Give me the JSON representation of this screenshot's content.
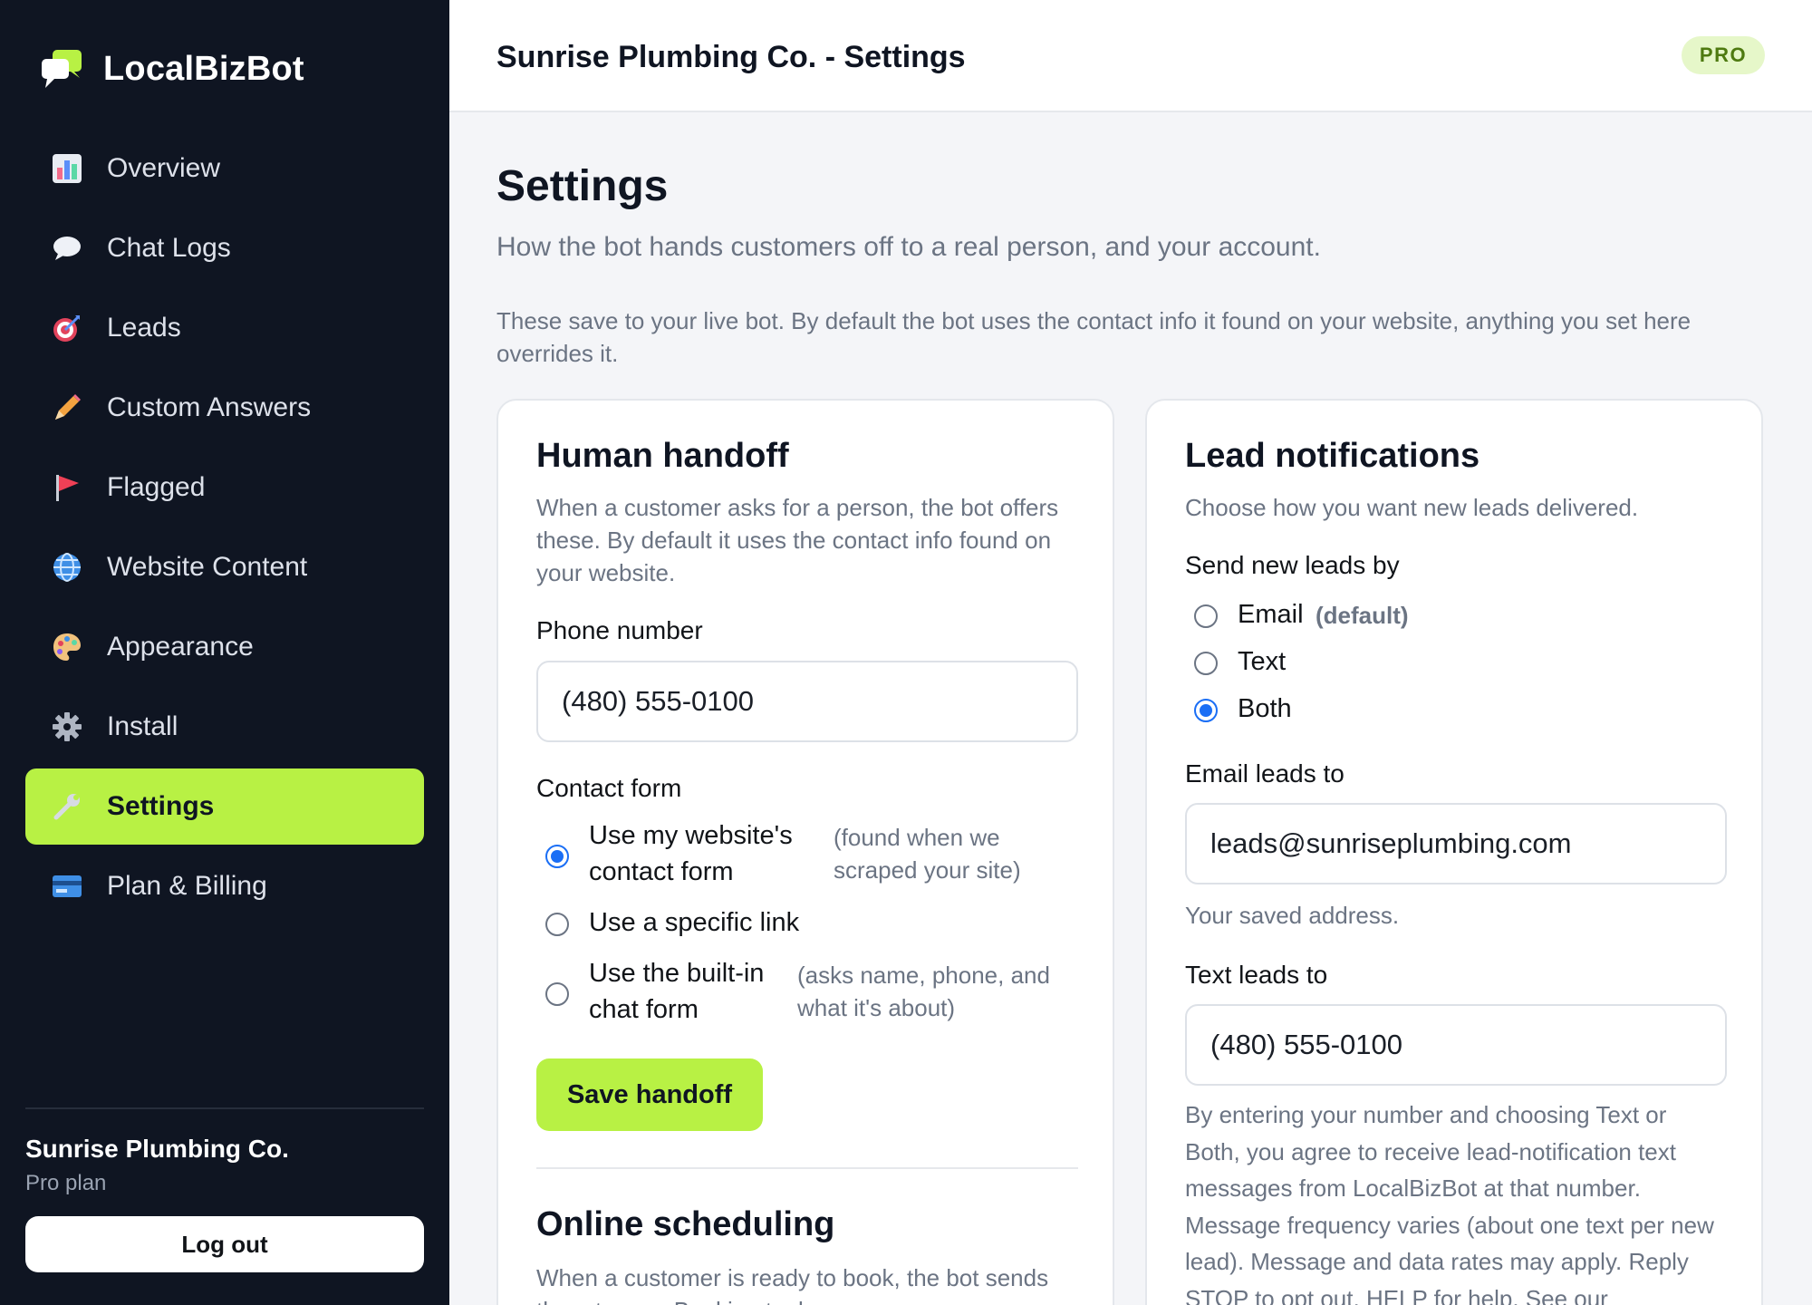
{
  "app": {
    "name": "LocalBizBot"
  },
  "sidebar": {
    "items": [
      {
        "label": "Overview",
        "icon": "bar-chart-icon"
      },
      {
        "label": "Chat Logs",
        "icon": "speech-bubble-icon"
      },
      {
        "label": "Leads",
        "icon": "target-icon"
      },
      {
        "label": "Custom Answers",
        "icon": "pencil-icon"
      },
      {
        "label": "Flagged",
        "icon": "flag-icon"
      },
      {
        "label": "Website Content",
        "icon": "globe-icon"
      },
      {
        "label": "Appearance",
        "icon": "palette-icon"
      },
      {
        "label": "Install",
        "icon": "gear-icon"
      },
      {
        "label": "Settings",
        "icon": "wrench-icon",
        "active": true
      },
      {
        "label": "Plan & Billing",
        "icon": "credit-card-icon"
      }
    ],
    "org_name": "Sunrise Plumbing Co.",
    "plan": "Pro plan",
    "logout_label": "Log out"
  },
  "header": {
    "title": "Sunrise Plumbing Co. - Settings",
    "badge": "PRO"
  },
  "page": {
    "title": "Settings",
    "subtitle": "How the bot hands customers off to a real person, and your account.",
    "note": "These save to your live bot. By default the bot uses the contact info it found on your website, anything you set here overrides it."
  },
  "handoff": {
    "title": "Human handoff",
    "desc": "When a customer asks for a person, the bot offers these. By default it uses the contact info found on your website.",
    "phone_label": "Phone number",
    "phone_value": "(480) 555-0100",
    "contact_form_label": "Contact form",
    "options": [
      {
        "label": "Use my website's contact form",
        "hint": "(found when we scraped your site)",
        "checked": true
      },
      {
        "label": "Use a specific link",
        "hint": "",
        "checked": false
      },
      {
        "label": "Use the built-in chat form",
        "hint": "(asks name, phone, and what it's about)",
        "checked": false
      }
    ],
    "save_label": "Save handoff",
    "scheduling_title": "Online scheduling",
    "scheduling_desc": "When a customer is ready to book, the bot sends them to your Booking tool."
  },
  "leads": {
    "title": "Lead notifications",
    "desc": "Choose how you want new leads delivered.",
    "send_by_label": "Send new leads by",
    "options": [
      {
        "label": "Email",
        "hint": "(default)",
        "checked": false
      },
      {
        "label": "Text",
        "hint": "",
        "checked": false
      },
      {
        "label": "Both",
        "hint": "",
        "checked": true
      }
    ],
    "email_label": "Email leads to",
    "email_value": "leads@sunriseplumbing.com",
    "email_help": "Your saved address.",
    "text_label": "Text leads to",
    "text_value": "(480) 555-0100",
    "consent": "By entering your number and choosing Text or Both, you agree to receive lead-notification text messages from LocalBizBot at that number. Message frequency varies (about one text per new lead). Message and data rates may apply. Reply STOP to opt out, HELP for help. See our"
  },
  "colors": {
    "sidebar_bg": "#0f1522",
    "accent": "#b8f144",
    "radio_checked": "#1a6ef5",
    "badge_bg": "#e6f7c9",
    "badge_text": "#4e7a10"
  }
}
